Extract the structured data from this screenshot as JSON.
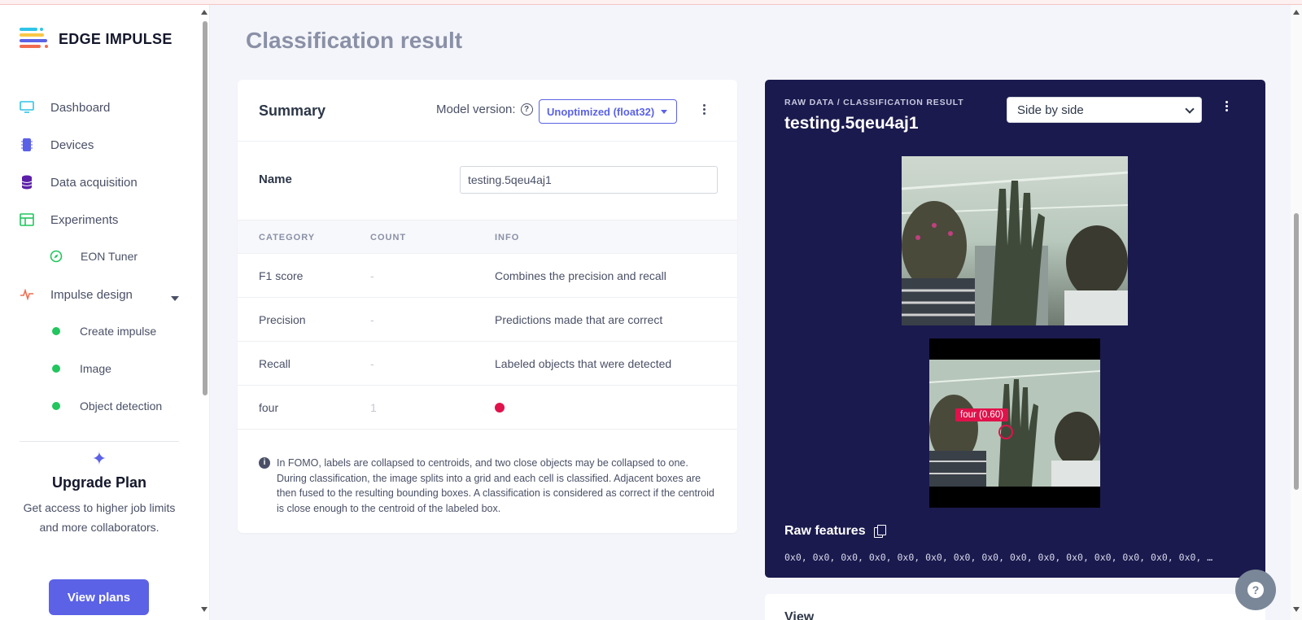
{
  "app": {
    "logo_text": "EDGE IMPULSE"
  },
  "sidebar": {
    "items": [
      {
        "label": "Dashboard",
        "icon": "monitor-icon"
      },
      {
        "label": "Devices",
        "icon": "chip-icon"
      },
      {
        "label": "Data acquisition",
        "icon": "database-icon"
      },
      {
        "label": "Experiments",
        "icon": "table-icon"
      },
      {
        "label": "EON Tuner",
        "icon": "compass-icon"
      },
      {
        "label": "Impulse design",
        "icon": "pulse-icon"
      },
      {
        "label": "Create impulse",
        "icon": "status-dot"
      },
      {
        "label": "Image",
        "icon": "status-dot"
      },
      {
        "label": "Object detection",
        "icon": "status-dot"
      }
    ],
    "upgrade": {
      "title": "Upgrade Plan",
      "text": "Get access to higher job limits and more collaborators.",
      "button": "View plans"
    }
  },
  "page": {
    "title": "Classification result"
  },
  "summary": {
    "title": "Summary",
    "model_version_label": "Model version:",
    "model_version_value": "Unoptimized (float32)",
    "name_label": "Name",
    "name_value": "testing.5qeu4aj1",
    "columns": [
      "CATEGORY",
      "COUNT",
      "INFO"
    ],
    "rows": [
      {
        "category": "F1 score",
        "count": "-",
        "info": "Combines the precision and recall"
      },
      {
        "category": "Precision",
        "count": "-",
        "info": "Predictions made that are correct"
      },
      {
        "category": "Recall",
        "count": "-",
        "info": "Labeled objects that were detected"
      },
      {
        "category": "four",
        "count": "1",
        "info": "",
        "color": "#e0124b"
      }
    ],
    "note": "In FOMO, labels are collapsed to centroids, and two close objects may be collapsed to one. During classification, the image splits into a grid and each cell is classified. Adjacent boxes are then fused to the resulting bounding boxes. A classification is considered as correct if the centroid is close enough to the centroid of the labeled box."
  },
  "panel": {
    "breadcrumb": "RAW DATA / CLASSIFICATION RESULT",
    "sample_name": "testing.5qeu4aj1",
    "view_mode": "Side by side",
    "detection_label": "four (0.60)",
    "raw_features_title": "Raw features",
    "raw_features_values": "0x0, 0x0, 0x0, 0x0, 0x0, 0x0, 0x0, 0x0, 0x0, 0x0, 0x0, 0x0, 0x0, 0x0, 0x0, …"
  },
  "view_card": {
    "title": "View"
  },
  "colors": {
    "accent": "#5b62e6",
    "panel_bg": "#1b1a4e",
    "detection": "#e0124b",
    "success": "#22c55e"
  }
}
